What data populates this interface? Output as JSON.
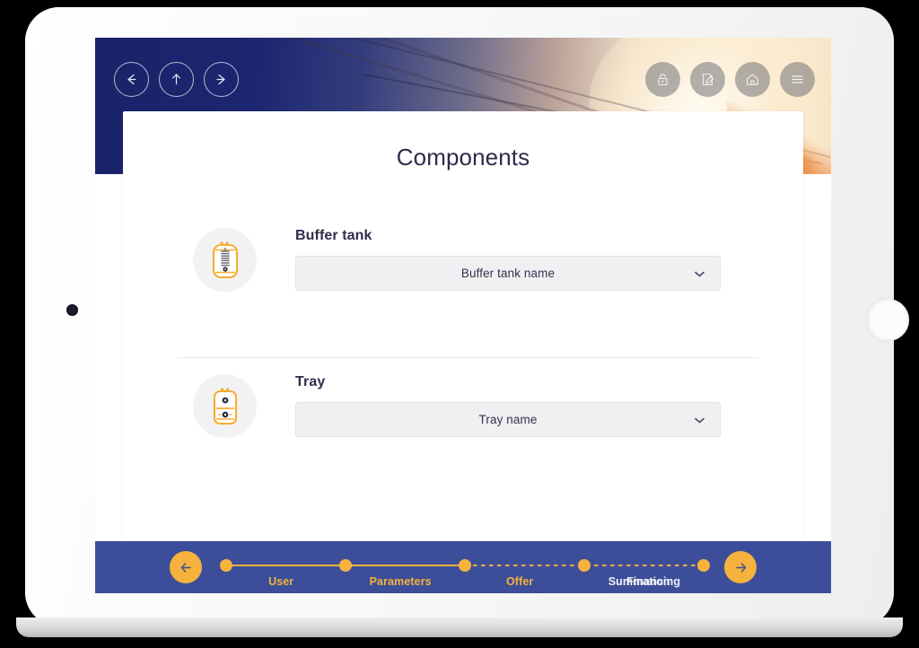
{
  "header": {
    "nav_buttons": [
      {
        "name": "back-button",
        "icon": "arrow-left-icon"
      },
      {
        "name": "up-button",
        "icon": "arrow-up-icon"
      },
      {
        "name": "forward-button",
        "icon": "arrow-right-icon"
      }
    ],
    "util_buttons": [
      {
        "name": "lock-button",
        "icon": "padlock-icon"
      },
      {
        "name": "edit-button",
        "icon": "edit-document-icon"
      },
      {
        "name": "home-button",
        "icon": "home-icon"
      },
      {
        "name": "menu-button",
        "icon": "hamburger-menu-icon"
      }
    ]
  },
  "main": {
    "title": "Components",
    "components": [
      {
        "label": "Buffer tank",
        "icon": "buffer-tank-icon",
        "select_value": "Buffer tank name"
      },
      {
        "label": "Tray",
        "icon": "tray-icon",
        "select_value": "Tray name"
      }
    ]
  },
  "footer": {
    "prev_button_icon": "arrow-left-icon",
    "next_button_icon": "arrow-right-icon",
    "steps": [
      {
        "label": "User",
        "state": "completed"
      },
      {
        "label": "Parameters",
        "state": "completed"
      },
      {
        "label": "Offer",
        "state": "current"
      },
      {
        "label": "Summation",
        "state": "upcoming"
      },
      {
        "label": "Financing",
        "state": "upcoming"
      }
    ]
  },
  "colors": {
    "accent_orange": "#f5b23c",
    "footer_blue": "#3c4e99",
    "header_navy": "#1e2a6e",
    "title_text": "#2e2c4a"
  }
}
